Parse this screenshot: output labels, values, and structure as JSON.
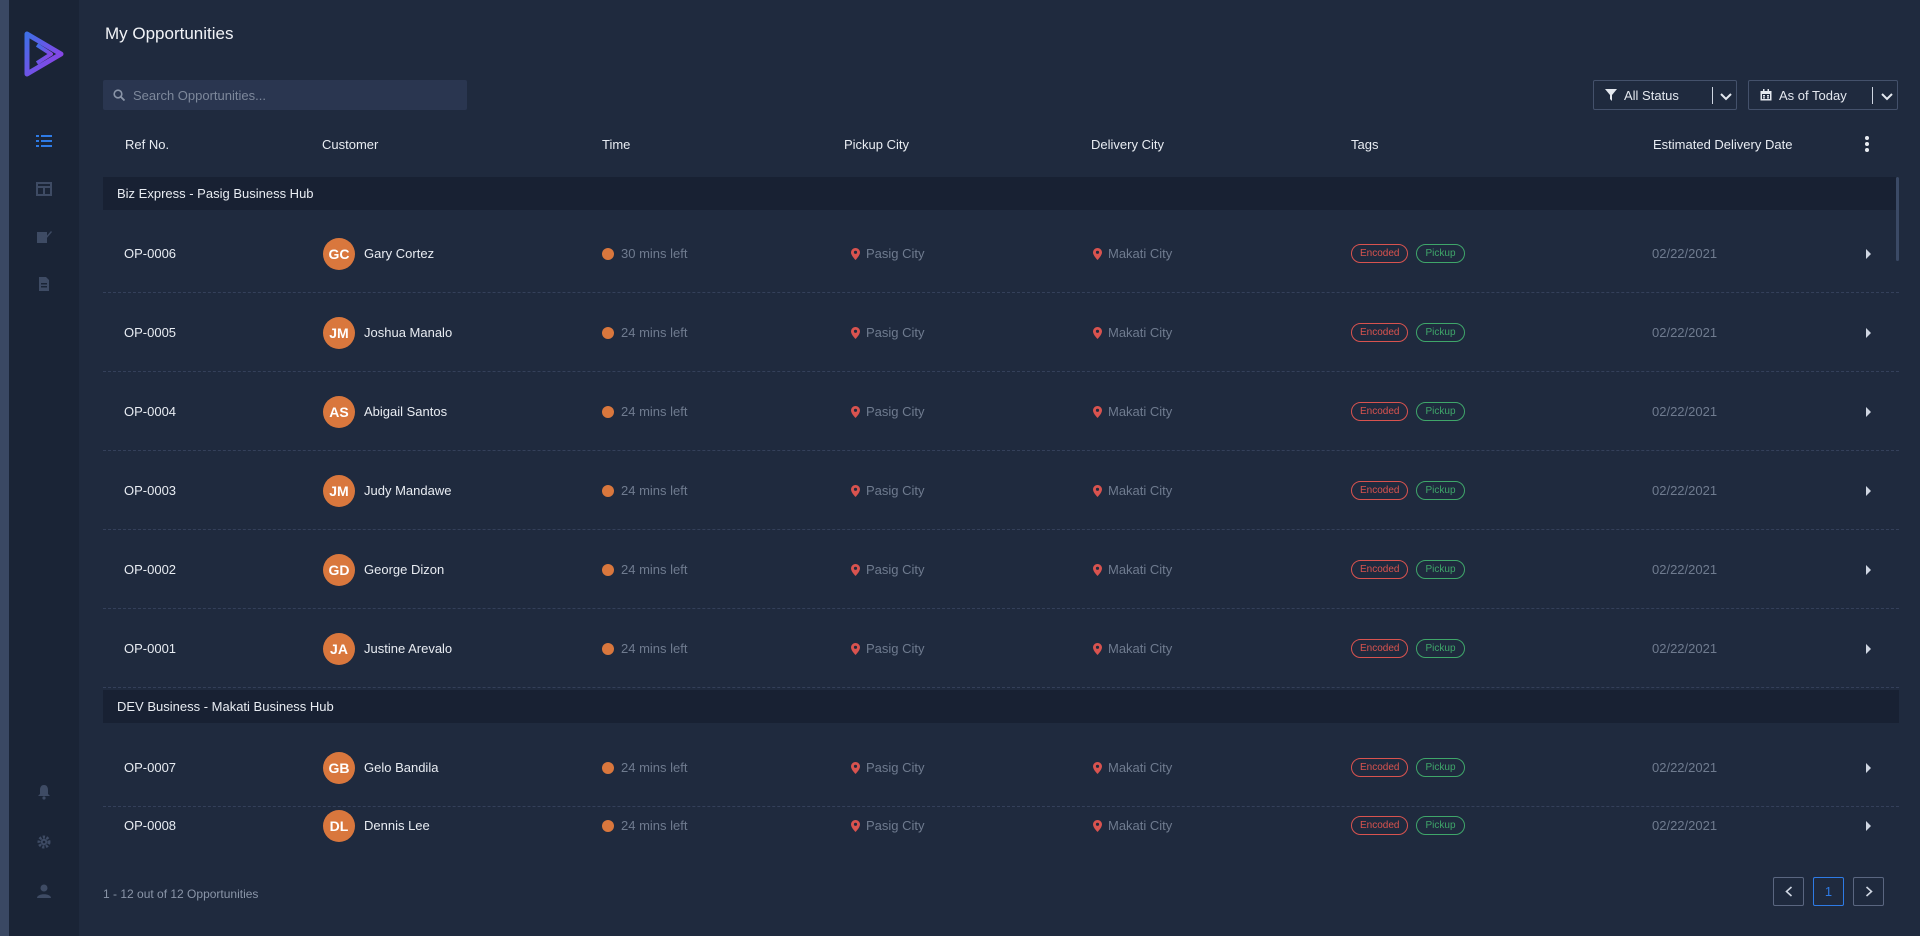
{
  "page": {
    "title": "My Opportunities"
  },
  "search": {
    "placeholder": "Search Opportunities..."
  },
  "filters": {
    "status_label": "All Status",
    "date_label": "As of Today"
  },
  "columns": [
    "Ref No.",
    "Customer",
    "Time",
    "Pickup City",
    "Delivery City",
    "Tags",
    "Estimated Delivery Date"
  ],
  "groups": [
    {
      "name": "Biz Express - Pasig Business Hub"
    },
    {
      "name": "DEV Business - Makati Business Hub"
    }
  ],
  "rows": [
    {
      "ref": "OP-0006",
      "initials": "GC",
      "customer": "Gary Cortez",
      "time": "30 mins left",
      "pickup": "Pasig City",
      "delivery": "Makati City",
      "tag1": "Encoded",
      "tag2": "Pickup",
      "date": "02/22/2021"
    },
    {
      "ref": "OP-0005",
      "initials": "JM",
      "customer": "Joshua Manalo",
      "time": "24 mins left",
      "pickup": "Pasig City",
      "delivery": "Makati City",
      "tag1": "Encoded",
      "tag2": "Pickup",
      "date": "02/22/2021"
    },
    {
      "ref": "OP-0004",
      "initials": "AS",
      "customer": "Abigail Santos",
      "time": "24 mins left",
      "pickup": "Pasig City",
      "delivery": "Makati City",
      "tag1": "Encoded",
      "tag2": "Pickup",
      "date": "02/22/2021"
    },
    {
      "ref": "OP-0003",
      "initials": "JM",
      "customer": "Judy Mandawe",
      "time": "24 mins left",
      "pickup": "Pasig City",
      "delivery": "Makati City",
      "tag1": "Encoded",
      "tag2": "Pickup",
      "date": "02/22/2021"
    },
    {
      "ref": "OP-0002",
      "initials": "GD",
      "customer": "George Dizon",
      "time": "24 mins left",
      "pickup": "Pasig City",
      "delivery": "Makati City",
      "tag1": "Encoded",
      "tag2": "Pickup",
      "date": "02/22/2021"
    },
    {
      "ref": "OP-0001",
      "initials": "JA",
      "customer": "Justine Arevalo",
      "time": "24 mins left",
      "pickup": "Pasig City",
      "delivery": "Makati City",
      "tag1": "Encoded",
      "tag2": "Pickup",
      "date": "02/22/2021"
    },
    {
      "ref": "OP-0007",
      "initials": "GB",
      "customer": "Gelo Bandila",
      "time": "24 mins left",
      "pickup": "Pasig City",
      "delivery": "Makati City",
      "tag1": "Encoded",
      "tag2": "Pickup",
      "date": "02/22/2021"
    },
    {
      "ref": "OP-0008",
      "initials": "DL",
      "customer": "Dennis Lee",
      "time": "24 mins left",
      "pickup": "Pasig City",
      "delivery": "Makati City",
      "tag1": "Encoded",
      "tag2": "Pickup",
      "date": "02/22/2021"
    }
  ],
  "footer": {
    "count_text": "1 - 12 out of 12 Opportunities",
    "current_page": "1"
  },
  "icons": [
    "logo-icon",
    "list-icon",
    "columns-icon",
    "edit-icon",
    "document-icon",
    "bell-icon",
    "gear-icon",
    "user-icon",
    "search-icon",
    "filter-icon",
    "calendar-icon",
    "chevron-down-icon",
    "kebab-icon",
    "map-pin-icon",
    "caret-right-icon",
    "chevron-left-icon",
    "chevron-right-icon"
  ],
  "colors": {
    "background": "#1f2a3e",
    "sidebar": "#1a2436",
    "accent": "#2e7be6",
    "avatar": "#d9773d",
    "encoded": "#d9534f",
    "pickup": "#3fa66a"
  }
}
